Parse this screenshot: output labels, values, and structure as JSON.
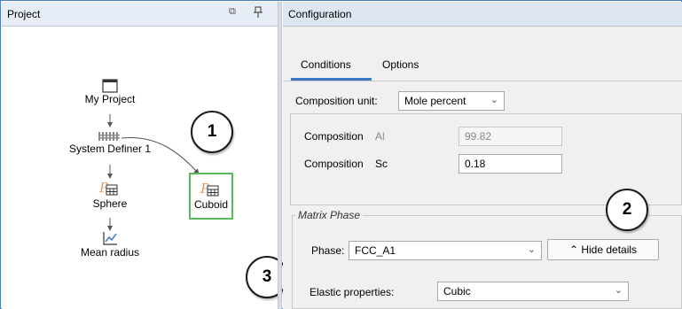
{
  "project_panel": {
    "title": "Project",
    "nodes": {
      "my_project": "My Project",
      "system_definer": "System Definer 1",
      "sphere": "Sphere",
      "cuboid": "Cuboid",
      "mean_radius": "Mean radius"
    }
  },
  "callouts": [
    "1",
    "2",
    "3"
  ],
  "config_panel": {
    "title": "Configuration",
    "tabs": [
      "Conditions",
      "Options"
    ],
    "composition_unit": {
      "label": "Composition unit:",
      "value": "Mole percent"
    },
    "compositions": [
      {
        "label": "Composition",
        "element": "Al",
        "value": "99.82"
      },
      {
        "label": "Composition",
        "element": "Sc",
        "value": "0.18"
      }
    ],
    "matrix_phase": {
      "title": "Matrix Phase",
      "phase_label": "Phase:",
      "phase_value": "FCC_A1",
      "hide_details": "Hide details",
      "elastic_label": "Elastic properties:",
      "elastic_value": "Cubic"
    }
  },
  "colors": {
    "accent": "#3c78c4",
    "highlight_border": "#5cb85c",
    "header_bg": "#e6edf6"
  }
}
